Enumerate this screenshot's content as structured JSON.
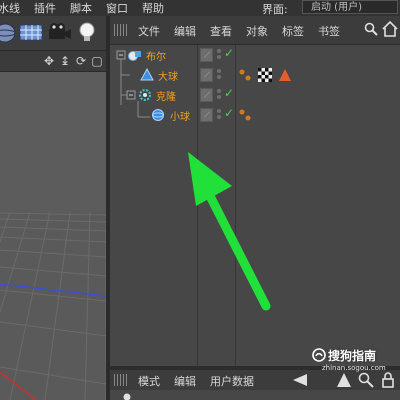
{
  "menubar": {
    "items": [
      "水线",
      "插件",
      "脚本",
      "窗口",
      "帮助"
    ],
    "layout_label": "界面:",
    "layout_value": "启动 (用户)"
  },
  "viewport": {
    "tool_icons": [
      "sphere-tool-icon",
      "grid-tool-icon",
      "camera-tool-icon",
      "light-tool-icon"
    ],
    "nav_icons": [
      "move-view-icon",
      "dolly-view-icon",
      "rotate-view-icon",
      "maximize-view-icon"
    ]
  },
  "object_manager": {
    "menu": [
      "文件",
      "编辑",
      "查看",
      "对象",
      "标签",
      "书签"
    ],
    "objects": [
      {
        "name": "布尔",
        "icon": "boolean-icon",
        "level": 0,
        "expanded": true,
        "check": true,
        "tags": []
      },
      {
        "name": "大球",
        "icon": "sphere-icon",
        "level": 1,
        "expanded": false,
        "check": false,
        "tags": [
          "phong-tag-icon",
          "checker-material-icon",
          "triangle-tag-icon"
        ]
      },
      {
        "name": "克隆",
        "icon": "cloner-icon",
        "level": 1,
        "expanded": true,
        "check": true,
        "tags": []
      },
      {
        "name": "小球",
        "icon": "sphere-icon",
        "level": 2,
        "expanded": false,
        "check": true,
        "tags": [
          "phong-tag-icon"
        ]
      }
    ],
    "colors": {
      "name_text": "#f0a020",
      "check": "#3fd34a",
      "annotation_arrow": "#22e03a"
    }
  },
  "attributes": {
    "menu": [
      "模式",
      "编辑",
      "用户数据"
    ]
  },
  "watermark": {
    "title": "搜狗指南",
    "url": "zhinan.sogou.com"
  }
}
